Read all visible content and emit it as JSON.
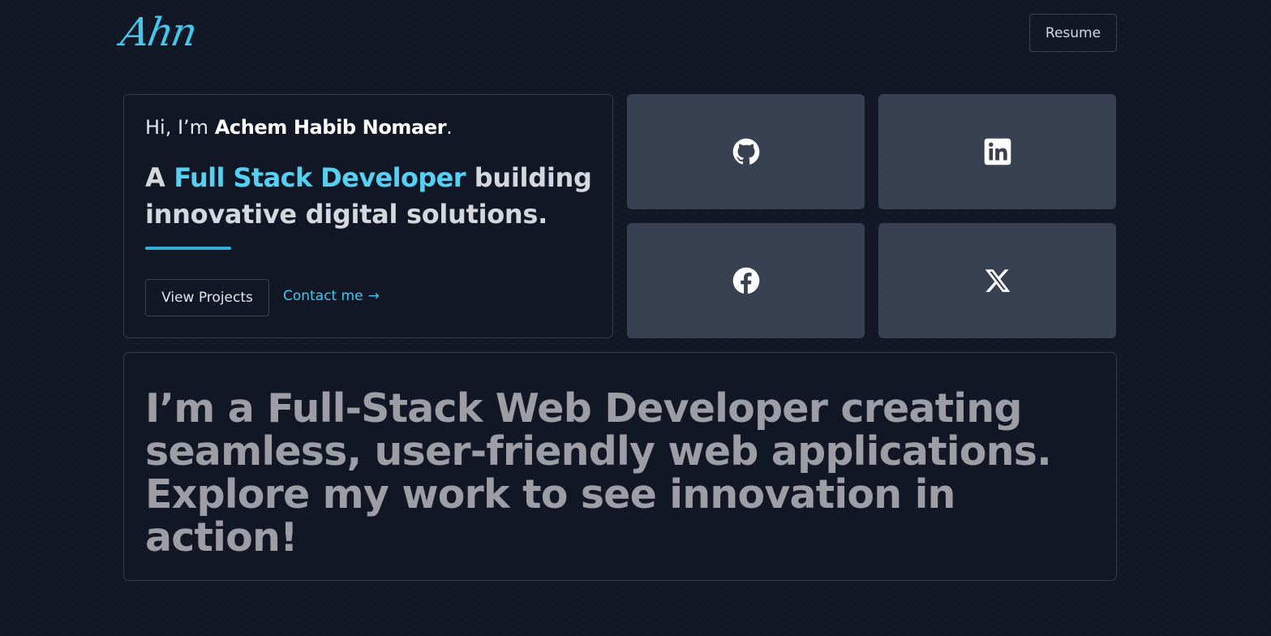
{
  "header": {
    "logo_text": "Ahn",
    "resume_label": "Resume"
  },
  "intro": {
    "greeting_prefix": "Hi, I’m ",
    "name": "Achem Habib Nomaer",
    "greeting_suffix": ".",
    "tagline_prefix": "A ",
    "role": "Full Stack Developer",
    "tagline_suffix": " building innovative digital solutions.",
    "view_projects_label": "View Projects",
    "contact_label": "Contact me",
    "contact_arrow": "→"
  },
  "social": [
    {
      "icon": "github-icon"
    },
    {
      "icon": "linkedin-icon"
    },
    {
      "icon": "facebook-icon"
    },
    {
      "icon": "x-icon"
    }
  ],
  "about": {
    "text": "I’m a Full-Stack Web Developer creating seamless, user-friendly web applications. Explore my work to see innovation in action!"
  },
  "colors": {
    "background": "#121826",
    "accent": "#45c6eb",
    "tile": "#374152",
    "border": "#343b4a",
    "about_text": "#9d9ea5"
  }
}
